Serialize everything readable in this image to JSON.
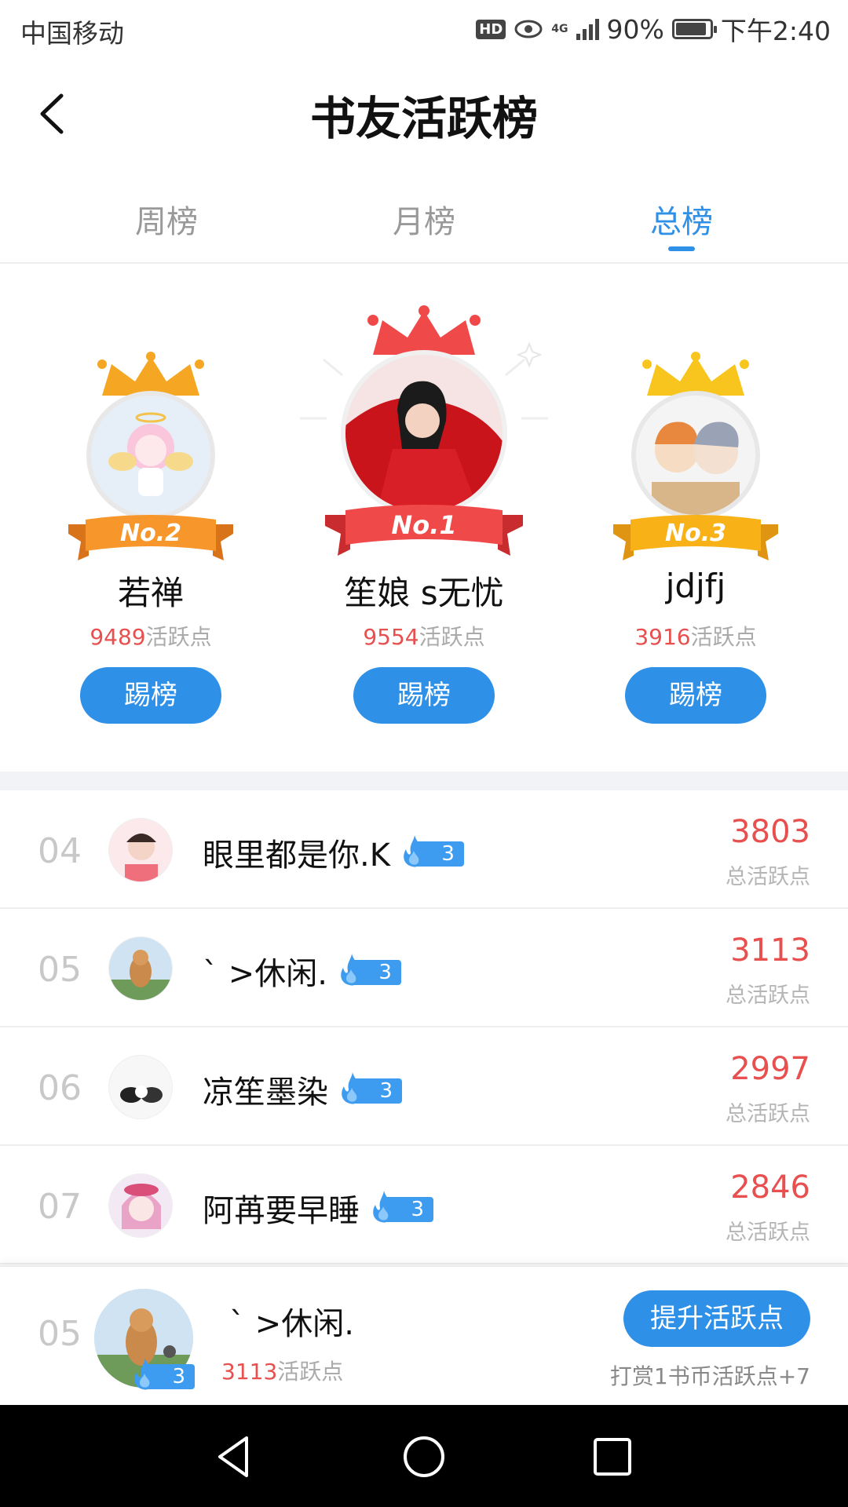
{
  "status_bar": {
    "carrier": "中国移动",
    "hd": "HD",
    "network": "4G",
    "battery": "90%",
    "battery_level": 0.9,
    "time": "下午2:40"
  },
  "header": {
    "title": "书友活跃榜"
  },
  "tabs": [
    {
      "label": "周榜",
      "active": false
    },
    {
      "label": "月榜",
      "active": false
    },
    {
      "label": "总榜",
      "active": true
    }
  ],
  "podium": {
    "points_suffix": "活跃点",
    "kick_label": "踢榜",
    "first": {
      "rank_label": "No.1",
      "name": "笙娘 s无忧",
      "points": "9554",
      "crown_color": "#f0494a",
      "ribbon_color": "#f0494a"
    },
    "second": {
      "rank_label": "No.2",
      "name": "若禅",
      "points": "9489",
      "crown_color": "#f5a623",
      "ribbon_color": "#f7962a"
    },
    "third": {
      "rank_label": "No.3",
      "name": "jdjfj",
      "points": "3916",
      "crown_color": "#f7c51e",
      "ribbon_color": "#f8b218"
    }
  },
  "list": {
    "points_label": "总活跃点",
    "rows": [
      {
        "rank": "04",
        "name": "眼里都是你.K",
        "level": "3",
        "points": "3803"
      },
      {
        "rank": "05",
        "name": "ˋ >休闲.",
        "level": "3",
        "points": "3113"
      },
      {
        "rank": "06",
        "name": "凉笙墨染",
        "level": "3",
        "points": "2997"
      },
      {
        "rank": "07",
        "name": "阿苒要早睡",
        "level": "3",
        "points": "2846"
      }
    ]
  },
  "my_rank": {
    "rank": "05",
    "name": "ˋ >休闲.",
    "level": "3",
    "points": "3113",
    "points_suffix": "活跃点",
    "boost_label": "提升活跃点",
    "reward_hint": "打赏1书币活跃点+7"
  },
  "colors": {
    "accent": "#2f90e8",
    "points_red": "#e84f4f"
  }
}
